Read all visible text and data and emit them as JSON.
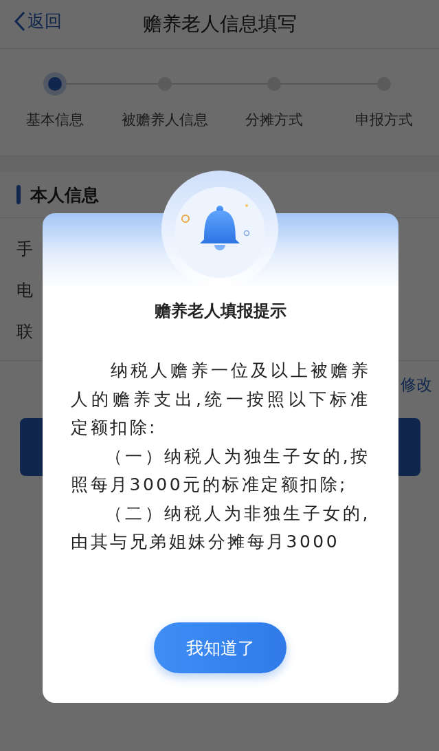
{
  "header": {
    "back": "返回",
    "title": "赡养老人信息填写"
  },
  "steps": [
    {
      "label": "基本信息",
      "selected": true
    },
    {
      "label": "被赡养人信息",
      "selected": false
    },
    {
      "label": "分摊方式",
      "selected": false
    },
    {
      "label": "申报方式",
      "selected": false
    }
  ],
  "section": {
    "title": "本人信息",
    "rows": [
      "手",
      "电",
      "联"
    ],
    "edit_link": "修改"
  },
  "dialog": {
    "title": "赡养老人填报提示",
    "paragraphs": [
      "纳税人赡养一位及以上被赡养人的赡养支出,统一按照以下标准定额扣除:",
      "（一）纳税人为独生子女的,按照每月3000元的标准定额扣除;",
      "（二）纳税人为非独生子女的,由其与兄弟姐妹分摊每月3000"
    ],
    "button": "我知道了"
  }
}
